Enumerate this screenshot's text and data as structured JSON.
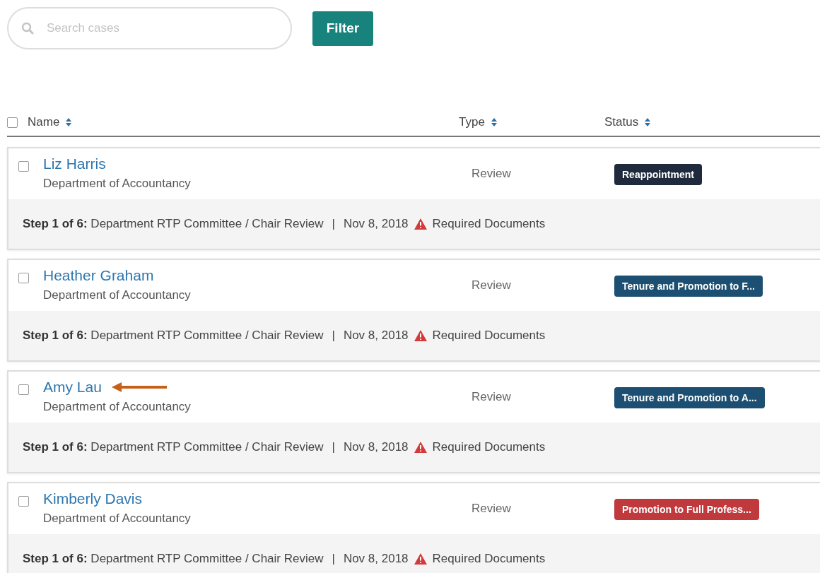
{
  "search": {
    "placeholder": "Search cases"
  },
  "filter_button": "Filter",
  "table": {
    "select_all": {
      "checked": false
    },
    "columns": [
      "Name",
      "Type",
      "Status"
    ],
    "rows": [
      {
        "checked": false,
        "name": "Liz Harris",
        "department": "Department of Accountancy",
        "type": "Review",
        "status": "Reappointment",
        "color": "#1f2a3d",
        "step": "**Step 1 of 6:** Department RTP Committee / Chair Review",
        "separator": "|",
        "date": "Nov 8, 2018",
        "documents": "Required Documents",
        "marked": false
      },
      {
        "checked": false,
        "name": "Heather Graham",
        "department": "Department of Accountancy",
        "type": "Review",
        "status": "Tenure and Promotion to F...",
        "color": "#1c4f72",
        "step": "**Step 1 of 6:** Department RTP Committee / Chair Review",
        "separator": "|",
        "date": "Nov 8, 2018",
        "documents": "Required Documents",
        "marked": false
      },
      {
        "checked": false,
        "name": "Amy Lau",
        "department": "Department of Accountancy",
        "type": "Review",
        "status": "Tenure and Promotion to A...",
        "color": "#1c4f72",
        "step": "**Step 1 of 6:** Department RTP Committee / Chair Review",
        "separator": "|",
        "date": "Nov 8, 2018",
        "documents": "Required Documents",
        "marked": true
      },
      {
        "checked": false,
        "name": "Kimberly Davis",
        "department": "Department of Accountancy",
        "type": "Review",
        "status": "Promotion to Full Profess...",
        "color": "#c0393c",
        "step": "**Step 1 of 6:** Department RTP Committee / Chair Review",
        "separator": "|",
        "date": "Nov 8, 2018",
        "documents": "Required Documents",
        "marked": false
      }
    ]
  }
}
